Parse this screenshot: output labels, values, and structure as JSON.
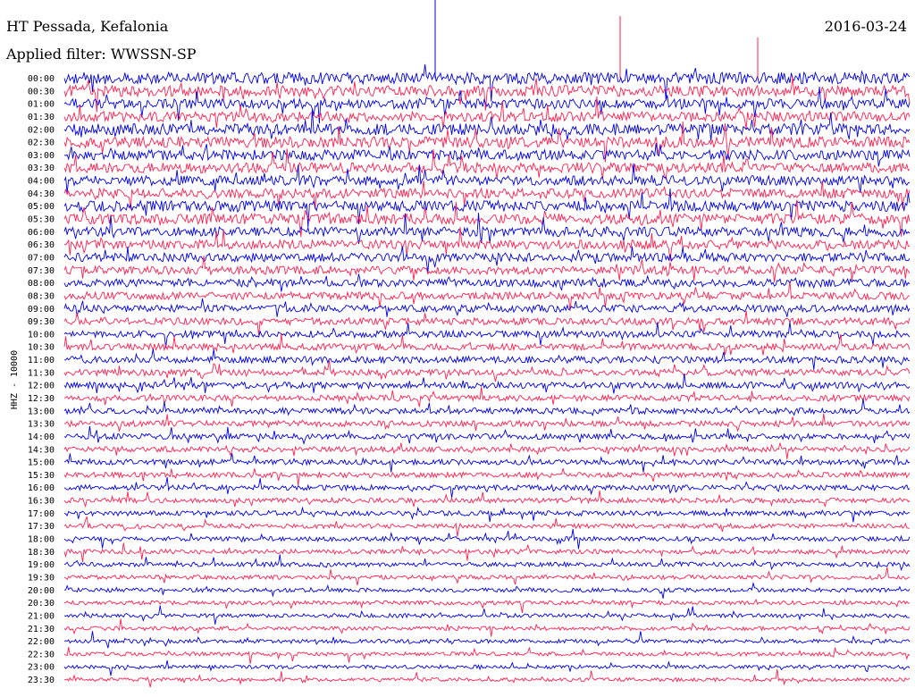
{
  "header": {
    "station": "HT Pessada, Kefalonia",
    "date": "2016-03-24",
    "filter": "Applied filter: WWSSN-SP"
  },
  "chart_data": {
    "type": "line",
    "title": "HT Pessada, Kefalonia",
    "subtitle": "Applied filter: WWSSN-SP",
    "date": "2016-03-24",
    "ylabel": "HHZ - 10000",
    "xlabel": "",
    "grid": false,
    "colors": {
      "odd_trace": "#0000e6",
      "even_trace": "#ff1f4f"
    },
    "ticks": [
      "00:00",
      "00:30",
      "01:00",
      "01:30",
      "02:00",
      "02:30",
      "03:00",
      "03:30",
      "04:00",
      "04:30",
      "05:00",
      "05:30",
      "06:00",
      "06:30",
      "07:00",
      "07:30",
      "08:00",
      "08:30",
      "09:00",
      "09:30",
      "10:00",
      "10:30",
      "11:00",
      "11:30",
      "12:00",
      "12:30",
      "13:00",
      "13:30",
      "14:00",
      "14:30",
      "15:00",
      "15:30",
      "16:00",
      "16:30",
      "17:00",
      "17:30",
      "18:00",
      "18:30",
      "19:00",
      "19:30",
      "20:00",
      "20:30",
      "21:00",
      "21:30",
      "22:00",
      "22:30",
      "23:00",
      "23:30"
    ],
    "noise_level": [
      1.55,
      1.45,
      1.35,
      1.35,
      1.5,
      1.45,
      1.35,
      1.35,
      1.3,
      1.3,
      1.45,
      1.4,
      1.25,
      1.2,
      1.15,
      1.1,
      1.05,
      1.0,
      0.95,
      0.95,
      0.9,
      0.9,
      0.9,
      0.85,
      0.85,
      0.8,
      0.8,
      0.78,
      0.75,
      0.72,
      0.72,
      0.7,
      0.7,
      0.68,
      0.66,
      0.64,
      0.62,
      0.62,
      0.6,
      0.58,
      0.56,
      0.55,
      0.54,
      0.53,
      0.52,
      0.51,
      0.5,
      0.5
    ]
  }
}
